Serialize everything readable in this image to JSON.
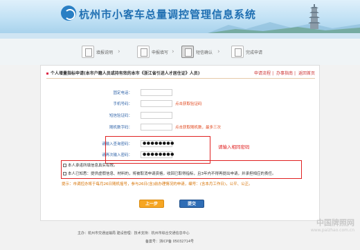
{
  "header": {
    "title": "杭州市小客车总量调控管理信息系统"
  },
  "steps": [
    {
      "label": "填报说明"
    },
    {
      "label": "申报填写"
    },
    {
      "label": "短信确认"
    },
    {
      "label": "完成申请"
    }
  ],
  "panel": {
    "title": "个人增量指标申请(本市户籍人员或持有效的本市《浙江省引进人才居住证》人员)",
    "links": [
      "申请流程",
      "办事指南",
      "返回首页"
    ]
  },
  "form": {
    "rows": [
      {
        "label": "固定电话：",
        "value": "",
        "hint": ""
      },
      {
        "label": "手机号码：",
        "value": "",
        "hint": "点击获取验证码"
      },
      {
        "label": "短信验证码：",
        "value": "",
        "hint": ""
      },
      {
        "label": "随机数字码：",
        "value": "",
        "hint": "点击获取随机数，最多三次"
      },
      {
        "label": "请输入查询密码：",
        "value": "●●●●●●●●",
        "hint": ""
      },
      {
        "label": "请再次输入密码：",
        "value": "●●●●●●●●",
        "hint": ""
      }
    ],
    "red_note": "请输入相同密码"
  },
  "confirm": {
    "line1": "本人承诺所填信息真实有效。",
    "line2": "本人已知悉：提供虚假信息、材料的，将被取消申请资格，收回已取得指标，且3年内不得再提出申请，并承担相应的责任。"
  },
  "warning": "提示：市调控办将于每月26日随机摇号，参与26日(含)前办理情况的申请，编号：(含本月工作日)，公平、公正。",
  "buttons": {
    "prev": "上一步",
    "submit": "提交"
  },
  "footer": {
    "line1": "主办：杭州市交通运输局   建设管理：技术支持：杭州市综合交通信息中心",
    "line2": "备案号：浙ICP备 05032714号"
  },
  "watermark": {
    "cn": "中国牌照网",
    "url": "www.paizhao.com.cn"
  }
}
